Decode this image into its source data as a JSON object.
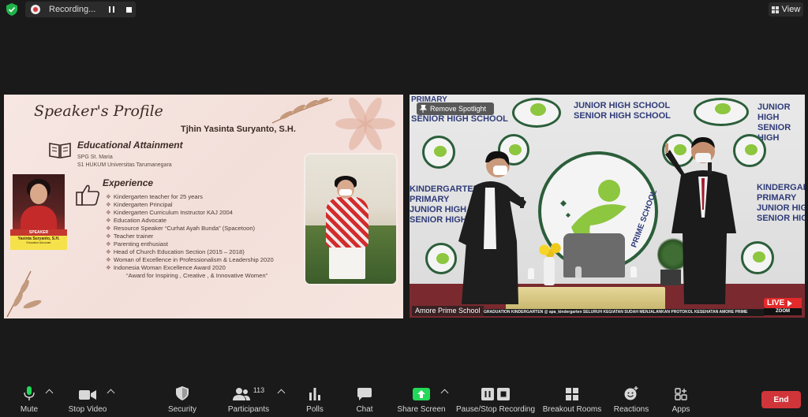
{
  "topbar": {
    "recording_label": "Recording...",
    "view_label": "View"
  },
  "slide": {
    "title": "Speaker's Profile",
    "speaker_name": "Tjhin Yasinta Suryanto, S.H.",
    "education": {
      "heading": "Educational Attainment",
      "items": [
        "SPG St. Maria",
        "S1 HUKUM Universitas Tarumanegara"
      ]
    },
    "speaker_tag": {
      "role": "SPEAKER",
      "name": "Yasinta Suryanto, S.H.",
      "caption": "Education Advocate"
    },
    "experience": {
      "heading": "Experience",
      "items": [
        "Kindergarten teacher for 25 years",
        "Kindergarten Principal",
        "Kindergarten Curriculum Instructor KAJ 2004",
        "Education Advocate",
        "Resource Speaker “Curhat Ayah Bunda” (Spacetoon)",
        "Teacher trainer",
        "Parenting enthusiast",
        "Head of Church Education Section (2015 – 2018)",
        "Woman of Excellence in Professionalism & Leadership 2020",
        "Indonesia Woman Excellence Award 2020"
      ],
      "award_note": "“Award for Inspiring , Creative , & Innovative Women”"
    }
  },
  "video": {
    "spotlight_label": "Remove Spotlight",
    "participant_name": "Amore Prime School",
    "backdrop_lines": [
      "PRIMARY",
      "JUNIOR HIGH SCHOOL",
      "SENIOR HIGH SCHOOL"
    ],
    "backdrop_right_lines": [
      "JUNIOR HIGH",
      "SENIOR HIGH"
    ],
    "backdrop_left_lines": [
      "KINDERGARTEN",
      "PRIMARY",
      "JUNIOR HIGH",
      "SENIOR HIGH"
    ],
    "backdrop_far_right_lines": [
      "KINDERGARTEN",
      "PRIMARY",
      "JUNIOR HIGH S",
      "SENIOR HIGH"
    ],
    "logo_text": "PRIME SCHOOL",
    "ticker": "GRADUATION KINDERGARTEN   @ apa_kindergarten   SELURUH KEGIATAN SUDAH MENJALANKAN PROTOKOL KESEHATAN   AMORE PRIME",
    "live_label": "LIVE",
    "live_brand": "ZOOM"
  },
  "toolbar": {
    "mute": "Mute",
    "stop_video": "Stop Video",
    "security": "Security",
    "participants": "Participants",
    "participants_count": "113",
    "polls": "Polls",
    "chat": "Chat",
    "share_screen": "Share Screen",
    "pause_stop_recording": "Pause/Stop Recording",
    "breakout_rooms": "Breakout Rooms",
    "reactions": "Reactions",
    "apps": "Apps",
    "end": "End"
  },
  "colors": {
    "share_green": "#23d959",
    "end_red": "#d0353a",
    "security_green": "#20b24a"
  }
}
